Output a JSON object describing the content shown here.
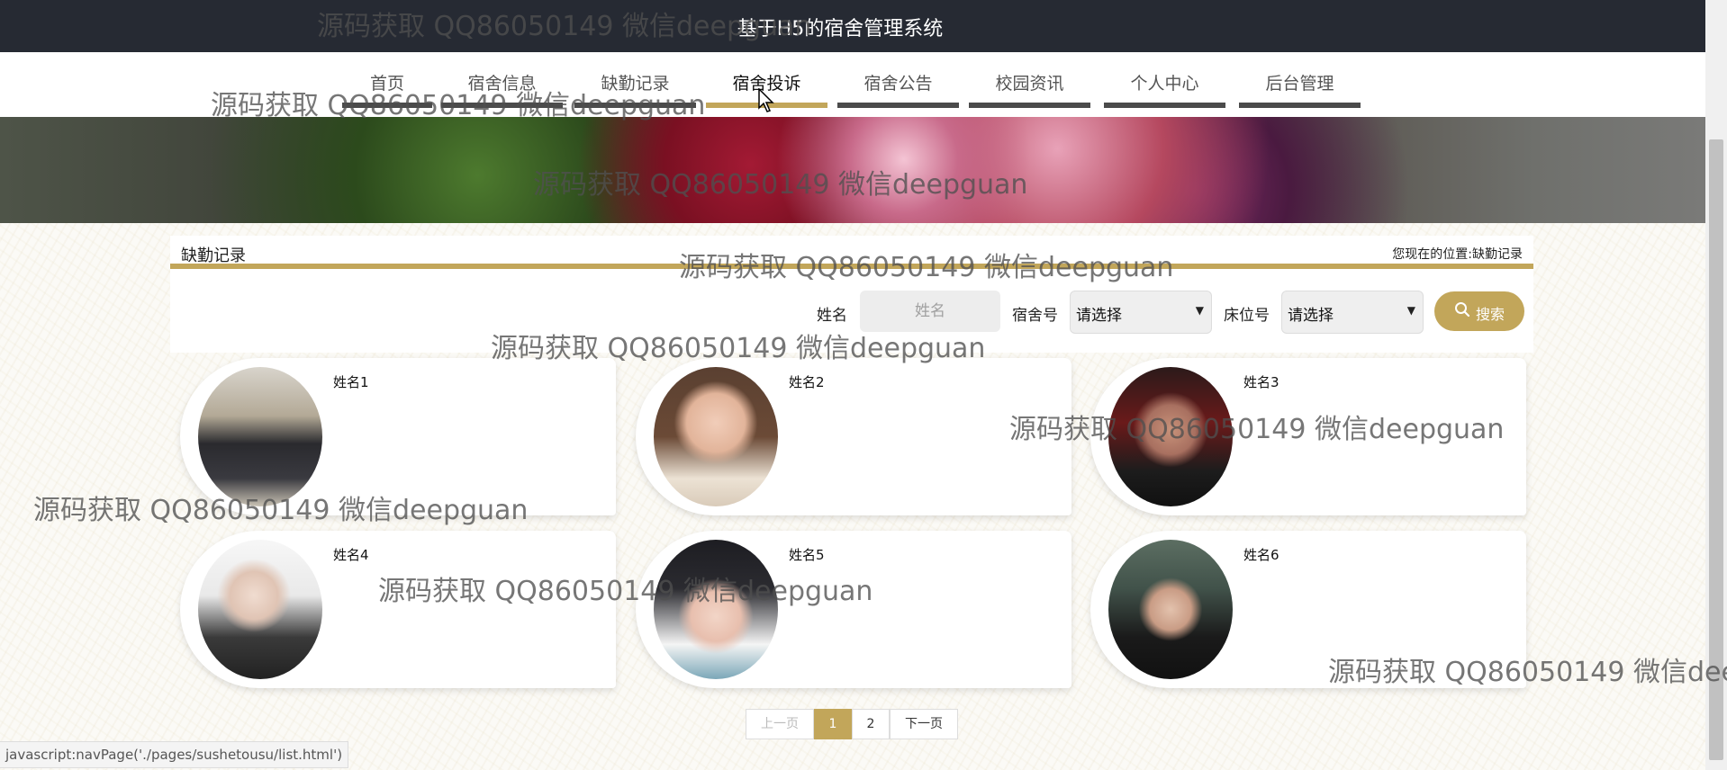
{
  "header": {
    "title": "基于H5的宿舍管理系统"
  },
  "nav": {
    "items": [
      {
        "label": "首页"
      },
      {
        "label": "宿舍信息"
      },
      {
        "label": "缺勤记录"
      },
      {
        "label": "宿舍投诉"
      },
      {
        "label": "宿舍公告"
      },
      {
        "label": "校园资讯"
      },
      {
        "label": "个人中心"
      },
      {
        "label": "后台管理"
      }
    ],
    "active": "宿舍投诉"
  },
  "section": {
    "title": "缺勤记录",
    "breadcrumb_label": "您现在的位置:",
    "breadcrumb_current": "缺勤记录"
  },
  "filters": {
    "name_label": "姓名",
    "name_placeholder": "姓名",
    "room_label": "宿舍号",
    "room_value": "请选择",
    "bed_label": "床位号",
    "bed_value": "请选择",
    "search_label": "搜索"
  },
  "cards": [
    {
      "name": "姓名1"
    },
    {
      "name": "姓名2"
    },
    {
      "name": "姓名3"
    },
    {
      "name": "姓名4"
    },
    {
      "name": "姓名5"
    },
    {
      "name": "姓名6"
    }
  ],
  "pagination": {
    "prev": "上一页",
    "pages": [
      "1",
      "2"
    ],
    "current": "1",
    "next": "下一页"
  },
  "status_bar": "javascript:navPage('./pages/sushetousu/list.html')",
  "watermark": "源码获取 QQ86050149 微信deepguan",
  "colors": {
    "accent": "#c2a65a",
    "topbar": "#262a33"
  }
}
